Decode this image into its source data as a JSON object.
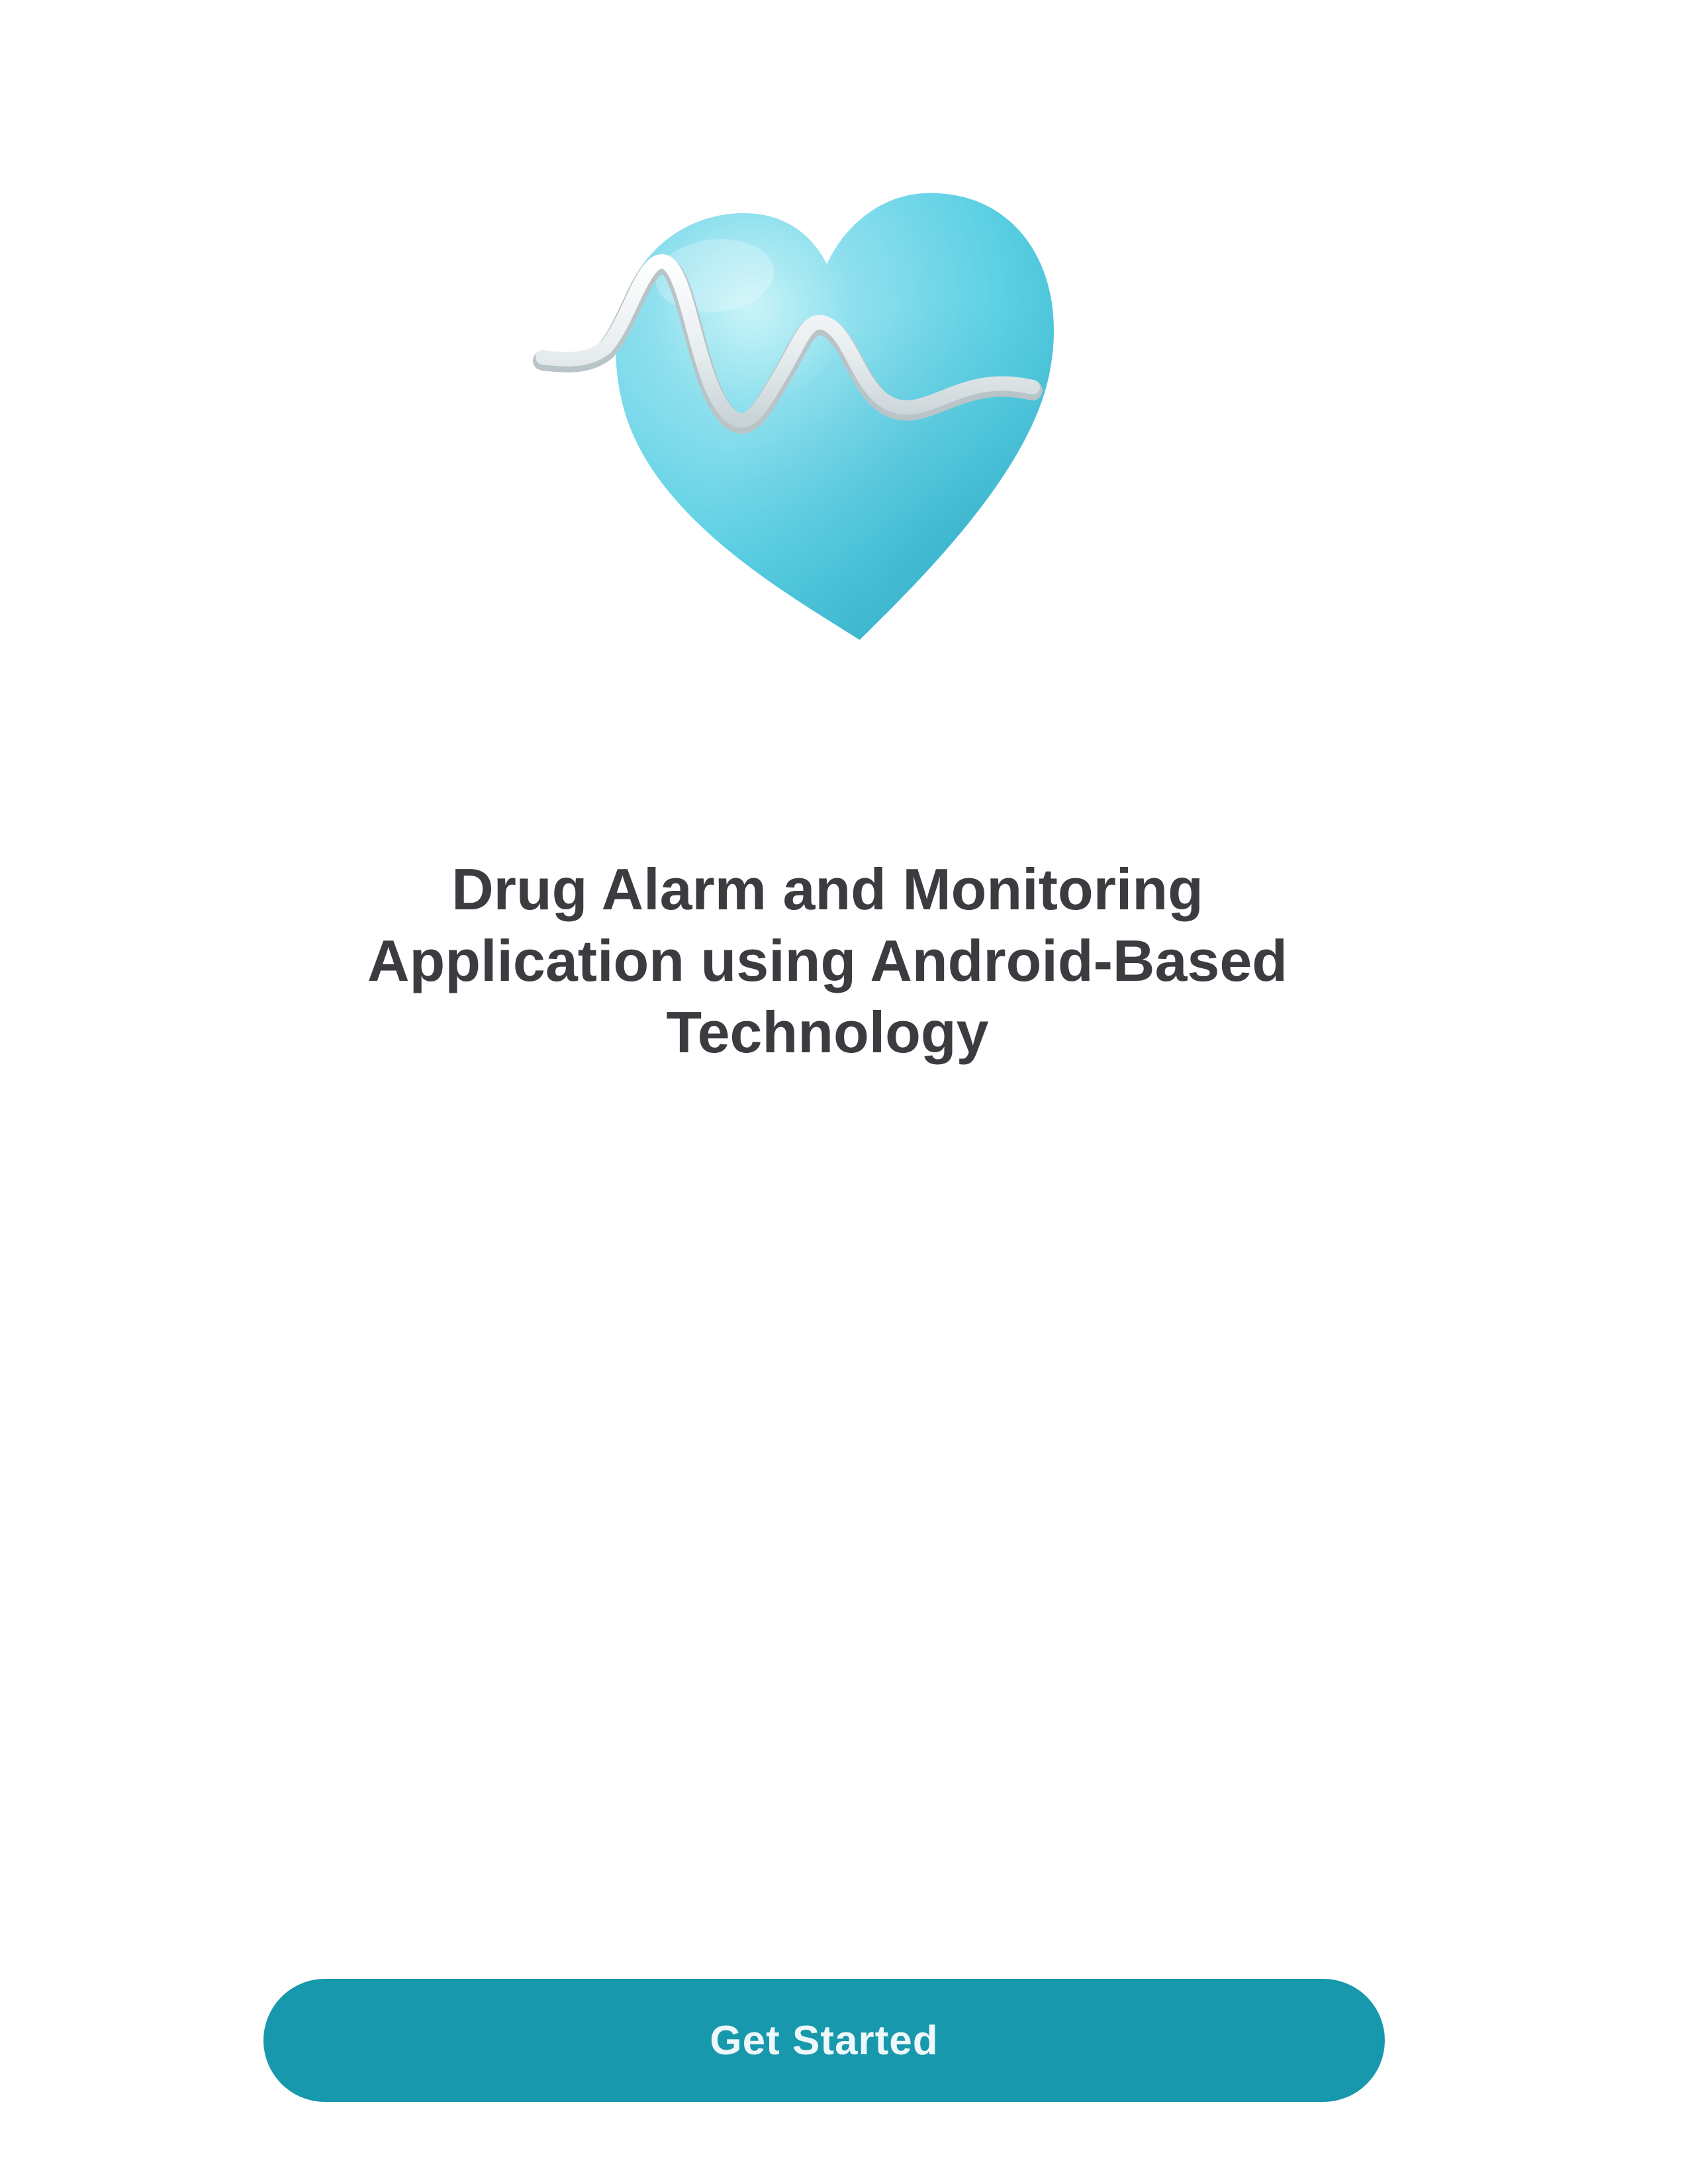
{
  "hero": {
    "icon": "heart-pulse-icon"
  },
  "title": {
    "line1": "Drug Alarm and Monitoring",
    "line2": "Application using Android-Based",
    "line3": "Technology"
  },
  "cta": {
    "label": "Get Started"
  },
  "colors": {
    "background": "#ffffff",
    "title_text": "#3d3a40",
    "button": "#1798ac",
    "button_text": "#eef7f9",
    "heart_light": "#a8eaf2",
    "heart_mid": "#5fd0e4",
    "heart_dark": "#3fb6cf",
    "pulse_line": "#e9eef0"
  }
}
